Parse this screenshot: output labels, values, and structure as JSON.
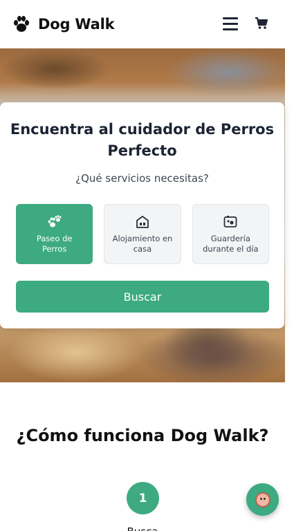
{
  "header": {
    "brand": "Dog Walk",
    "logo_icon": "paw-icon",
    "menu_icon": "hamburger-menu-icon",
    "cart_icon": "shopping-cart-icon"
  },
  "search_card": {
    "title": "Encuentra al cuidador de Perros Perfecto",
    "subtitle": "¿Qué servicios necesitas?",
    "options": [
      {
        "label": "Paseo de Perros",
        "icon": "paw-icon",
        "selected": true
      },
      {
        "label": "Alojamiento en casa",
        "icon": "house-icon",
        "selected": false
      },
      {
        "label": "Guardería durante el día",
        "icon": "daycare-icon",
        "selected": false
      }
    ],
    "search_button": "Buscar"
  },
  "how_it_works": {
    "title": "¿Cómo funciona Dog Walk?",
    "step_number": "1",
    "step_label": "Busca"
  },
  "fab": {
    "icon": "dog-face-icon"
  },
  "colors": {
    "accent": "#3daa82",
    "text_dark": "#1c2433",
    "option_bg": "#f3f4f6"
  }
}
